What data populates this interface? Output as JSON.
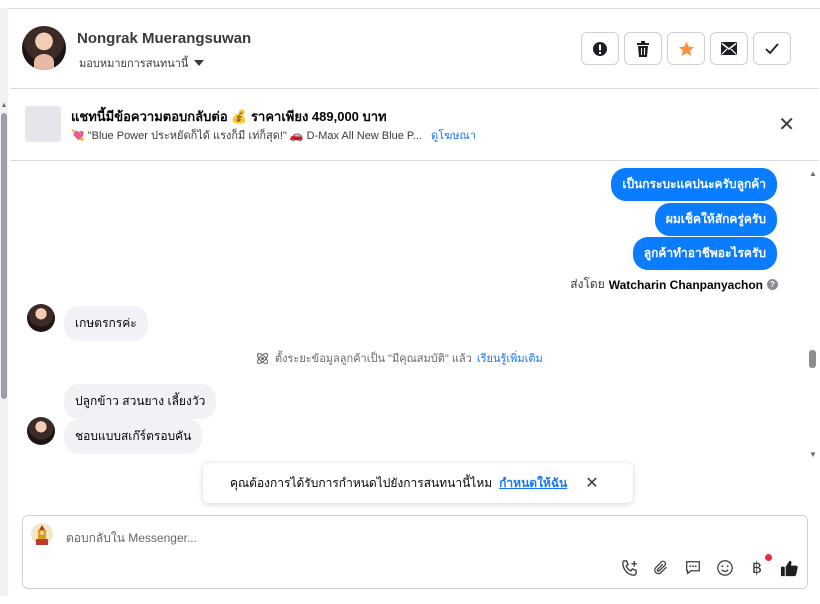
{
  "header": {
    "contact_name": "Nongrak Muerangsuwan",
    "assign_label": "มอบหมายการสนทนานี้",
    "actions": [
      {
        "name": "report-icon"
      },
      {
        "name": "trash-icon"
      },
      {
        "name": "star-icon",
        "color": "#f7923e"
      },
      {
        "name": "mail-icon"
      },
      {
        "name": "check-icon"
      }
    ]
  },
  "ad": {
    "title": "แชทนี้มีข้อความตอบกลับต่อ 💰 ราคาเพียง 489,000 บาท",
    "subtitle": "💘 \"Blue Power ประหยัดก็ได้ แรงก็มี เท่ก็สุด!\" 🚗 D-Max All New Blue P...",
    "link": "ดูโฆษณา"
  },
  "messages": {
    "outgoing": [
      "เป็นกระบะแคปนะครับลูกค้า",
      "ผมเช็คให้สักครู่ครับ",
      "ลูกค้าทำอาชีพอะไรครับ"
    ],
    "sent_by_prefix": "ส่งโดย",
    "sent_by_name": "Watcharin Chanpanyachon",
    "incoming_1": "เกษตรกรค่ะ",
    "system_note": "ตั้งระยะข้อมูลลูกค้าเป็น \"มีคุณสมบัติ\" แล้ว",
    "system_link": "เรียนรู้เพิ่มเติม",
    "incoming_2": "ปลูกข้าว สวนยาง เลี้ยงวัว",
    "incoming_3": "ชอบแบบสเก๊ร์ตรอบคัน"
  },
  "toast": {
    "text": "คุณต้องการได้รับการกำหนดไปยังการสนทนานี้ไหม",
    "link": "กำหนดให้ฉัน"
  },
  "composer": {
    "placeholder": "ตอบกลับใน Messenger...",
    "tools": [
      "phone-plus-icon",
      "paperclip-icon",
      "saved-reply-icon",
      "emoji-icon",
      "baht-icon",
      "thumbs-up-icon"
    ],
    "baht_symbol": "฿"
  },
  "colors": {
    "accent": "#0a7cff",
    "link": "#1877f2",
    "star": "#f7923e",
    "notification": "#f02849"
  }
}
